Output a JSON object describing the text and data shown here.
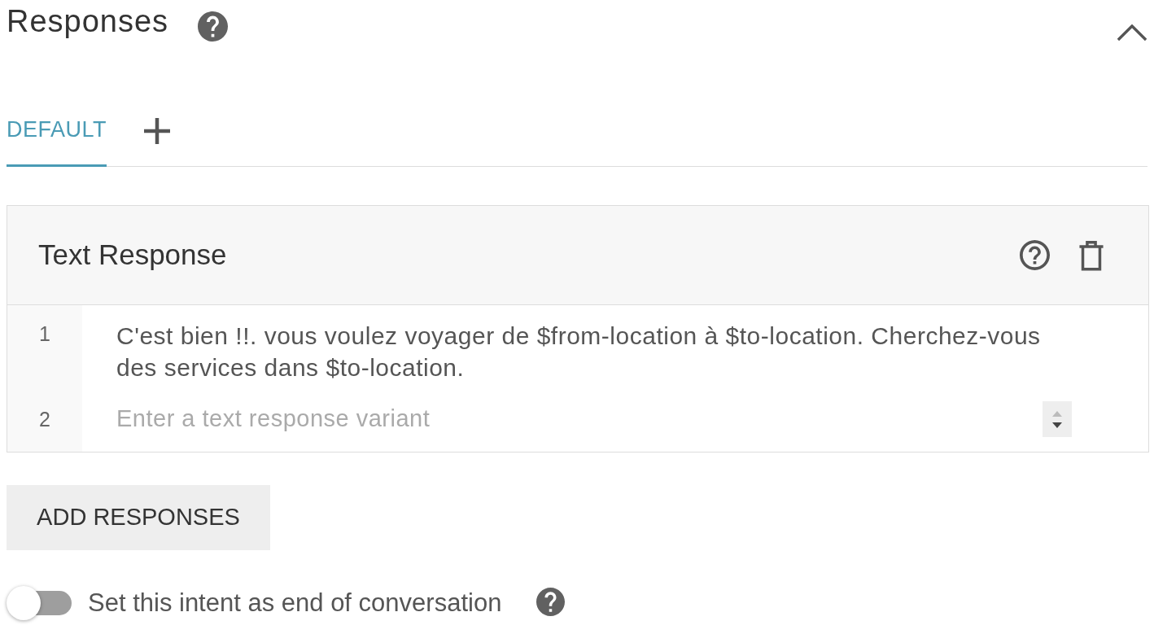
{
  "section": {
    "title": "Responses",
    "expanded": true
  },
  "tabs": [
    {
      "label": "DEFAULT",
      "selected": true
    }
  ],
  "text_response": {
    "title": "Text Response",
    "variants": [
      {
        "number": "1",
        "value": "C'est bien !!. vous voulez voyager de $from-location à $to-location. Cherchez-vous des services dans $to-location."
      },
      {
        "number": "2",
        "placeholder": "Enter a text response variant"
      }
    ]
  },
  "add_button": {
    "label": "ADD RESPONSES"
  },
  "end_of_conversation": {
    "label": "Set this intent as end of conversation",
    "on": false
  }
}
